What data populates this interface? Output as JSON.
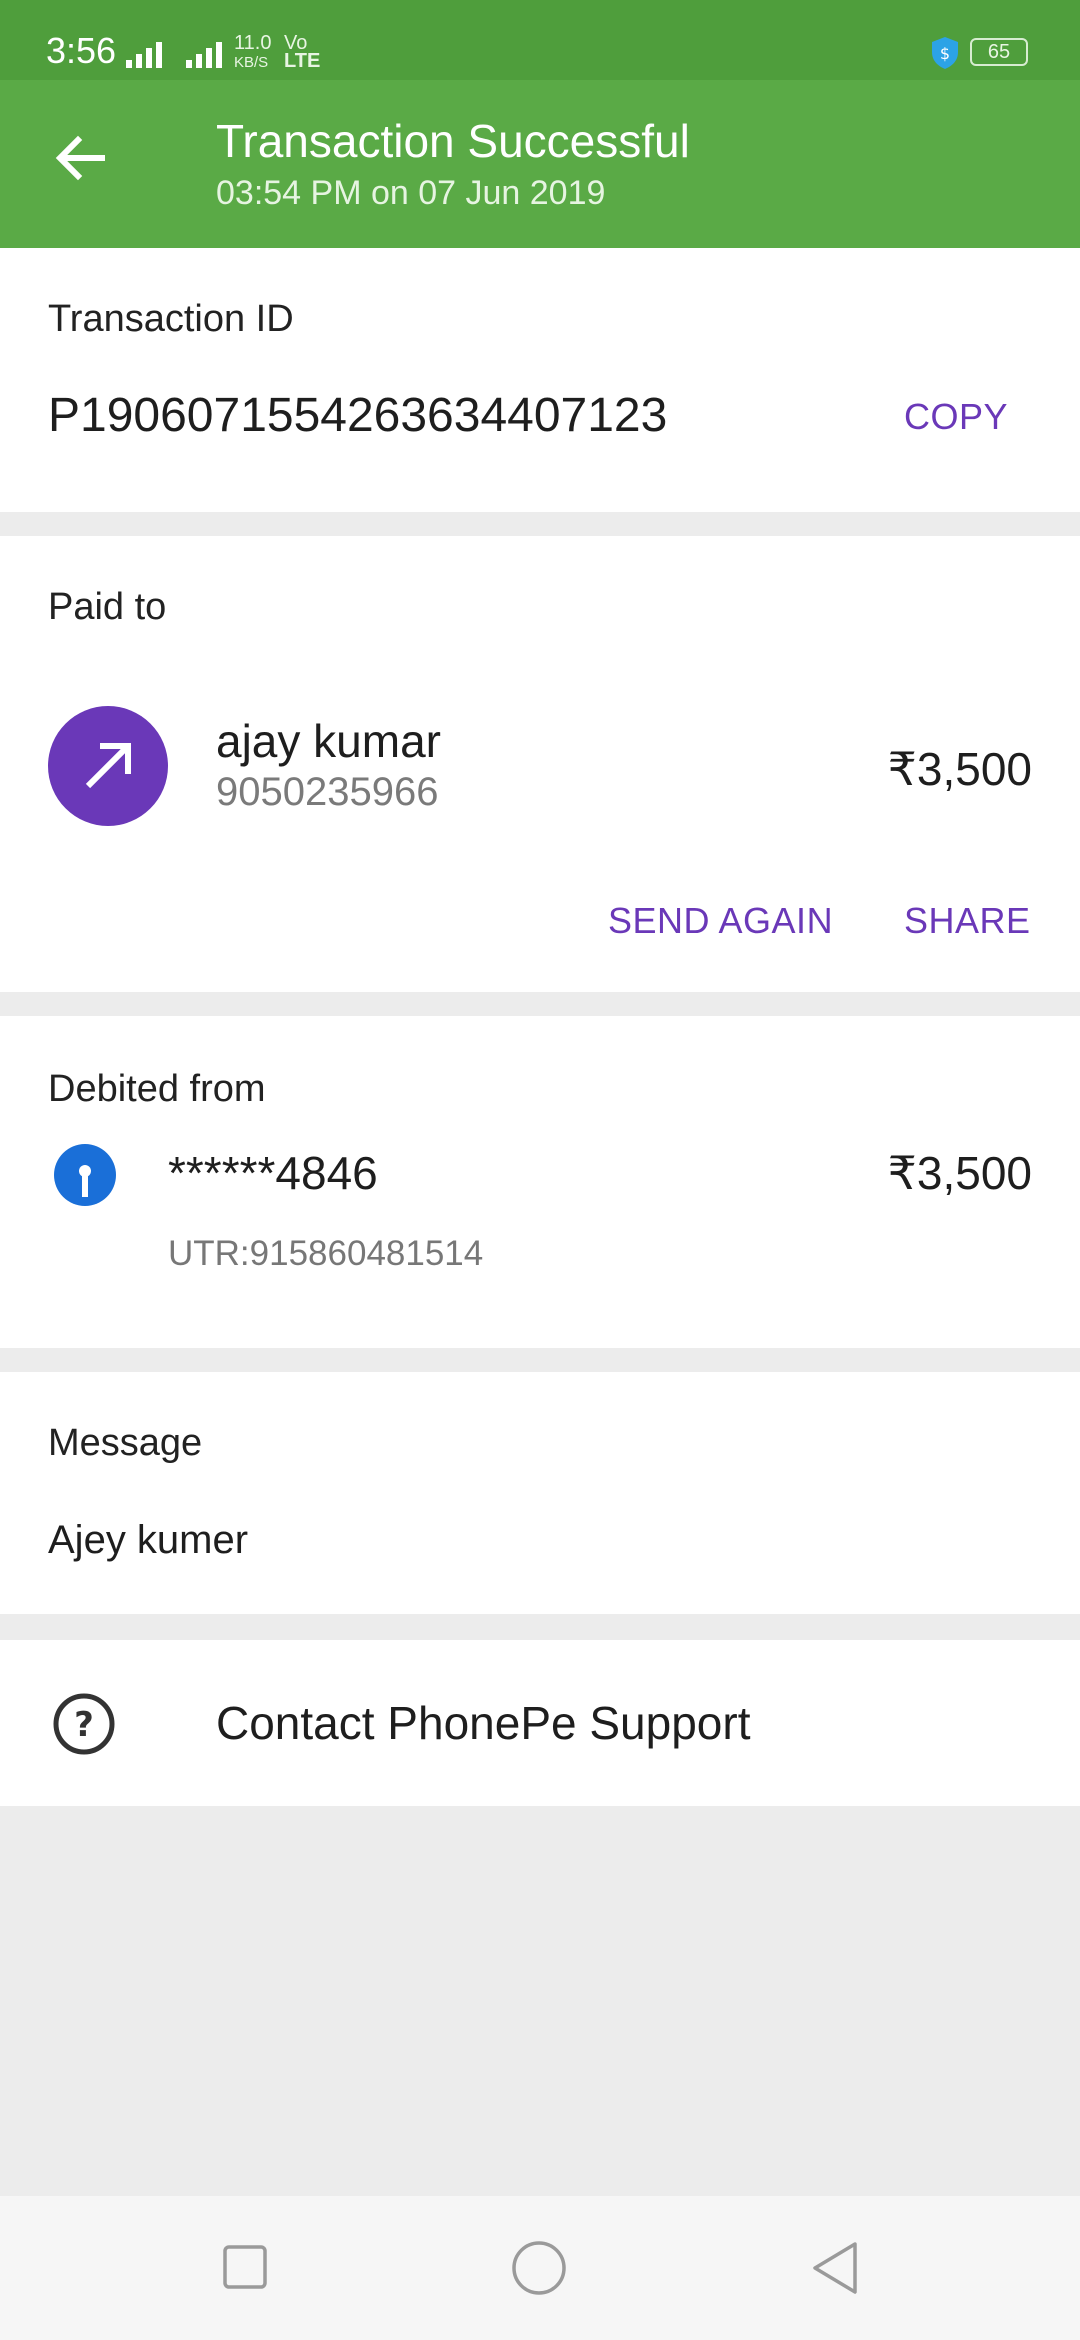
{
  "status_bar": {
    "time": "3:56",
    "net_speed_top": "11.0",
    "net_speed_unit": "KB/S",
    "volte_top": "Vo",
    "volte_bottom": "LTE",
    "battery": "65"
  },
  "header": {
    "title": "Transaction Successful",
    "subtitle": "03:54 PM on 07 Jun 2019",
    "bg_color": "#5aaa46"
  },
  "transaction": {
    "label": "Transaction ID",
    "id": "P1906071554263634407123",
    "copy_label": "COPY"
  },
  "paid_to": {
    "label": "Paid to",
    "name": "ajay kumar",
    "phone": "9050235966",
    "amount": "₹3,500",
    "send_again_label": "SEND AGAIN",
    "share_label": "SHARE",
    "accent_color": "#6a38b8"
  },
  "debited_from": {
    "label": "Debited from",
    "account": "******4846",
    "amount": "₹3,500",
    "utr": "UTR:915860481514"
  },
  "message": {
    "label": "Message",
    "text": "Ajey kumer"
  },
  "support": {
    "label": "Contact PhonePe Support"
  }
}
